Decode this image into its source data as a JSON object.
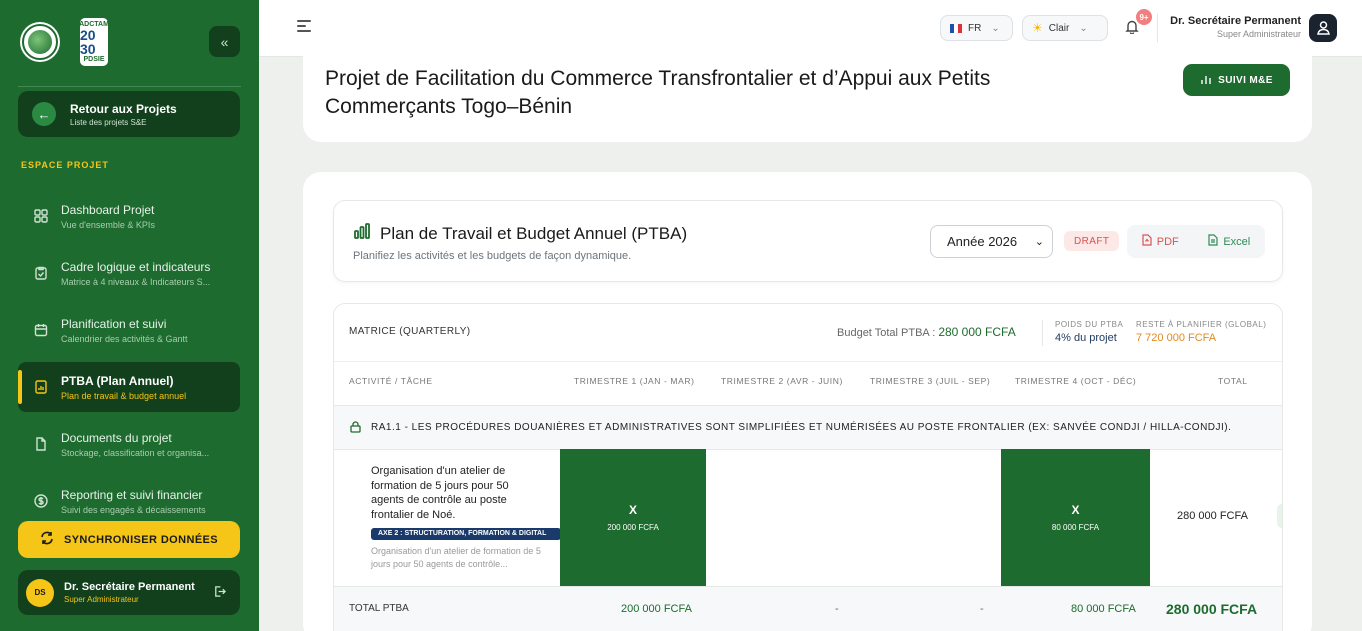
{
  "sidebar": {
    "logo_badge": {
      "top": "ADCTAM",
      "big": "20 30",
      "bottom": "PDSIE"
    },
    "back": {
      "title": "Retour aux Projets",
      "subtitle": "Liste des projets S&E"
    },
    "section_label": "ESPACE PROJET",
    "items": [
      {
        "label": "Dashboard Projet",
        "subtitle": "Vue d'ensemble & KPIs",
        "icon": "grid-icon"
      },
      {
        "label": "Cadre logique et indicateurs",
        "subtitle": "Matrice à 4 niveaux & Indicateurs S...",
        "icon": "clipboard-check-icon"
      },
      {
        "label": "Planification et suivi",
        "subtitle": "Calendrier des activités & Gantt",
        "icon": "calendar-icon"
      },
      {
        "label": "PTBA (Plan Annuel)",
        "subtitle": "Plan de travail & budget annuel",
        "icon": "chart-file-icon",
        "active": true
      },
      {
        "label": "Documents du projet",
        "subtitle": "Stockage, classification et organisa...",
        "icon": "document-icon"
      },
      {
        "label": "Reporting et suivi financier",
        "subtitle": "Suivi des engagés & décaissements",
        "icon": "dollar-icon"
      }
    ],
    "sync_label": "SYNCHRONISER DONNÉES",
    "user": {
      "initials": "DS",
      "name": "Dr. Secrétaire Permanent",
      "role": "Super Administrateur"
    }
  },
  "topbar": {
    "language": "FR",
    "theme": "Clair",
    "notif_badge": "9+",
    "user_name": "Dr. Secrétaire Permanent",
    "user_role": "Super Administrateur"
  },
  "project": {
    "title": "Projet de Facilitation du Commerce Transfrontalier et d’Appui aux Petits Commerçants Togo–Bénin",
    "suivi_label": "SUIVI M&E"
  },
  "ptba": {
    "title": "Plan de Travail et Budget Annuel (PTBA)",
    "subtitle": "Planifiez les activités et les budgets de façon dynamique.",
    "year": "Année 2026",
    "status": "DRAFT",
    "pdf_label": "PDF",
    "excel_label": "Excel"
  },
  "matrix": {
    "label": "MATRICE (QUARTERLY)",
    "budget_label": "Budget Total PTBA :",
    "budget_value": "280 000 FCFA",
    "weight_label": "POIDS DU PTBA",
    "weight_value": "4% du projet",
    "remaining_label": "RESTE À PLANIFIER (GLOBAL)",
    "remaining_value": "7 720 000 FCFA",
    "columns": [
      "ACTIVITÉ / TÂCHE",
      "TRIMESTRE 1 (JAN - MAR)",
      "TRIMESTRE 2 (AVR - JUIN)",
      "TRIMESTRE 3 (JUIL - SEP)",
      "TRIMESTRE 4 (OCT - DÉC)",
      "TOTAL"
    ],
    "result_area": "RA1.1 - LES PROCÉDURES DOUANIÈRES ET ADMINISTRATIVES SONT SIMPLIFIÉES ET NUMÉRISÉES AU POSTE FRONTALIER (EX: SANVÉE CONDJI / HILLA-CONDJI).",
    "task": {
      "title": "Organisation d'un atelier de formation de 5 jours pour 50 agents de contrôle au poste frontalier de Noé.",
      "axe": "AXE 2 : STRUCTURATION, FORMATION & DIGITAL",
      "note": "Organisation d'un atelier de formation de 5 jours pour 50 agents de contrôle...",
      "q1_mark": "X",
      "q1_amount": "200 000 FCFA",
      "q4_mark": "X",
      "q4_amount": "80 000 FCFA",
      "total": "280 000 FCFA"
    },
    "totals": {
      "label": "TOTAL PTBA",
      "q1": "200 000 FCFA",
      "q2": "-",
      "q3": "-",
      "q4": "80 000 FCFA",
      "total": "280 000 FCFA"
    }
  },
  "colors": {
    "primary": "#1e6b2f",
    "dark": "#123f1c",
    "accent": "#f5c518",
    "remaining": "#e08a1e"
  }
}
